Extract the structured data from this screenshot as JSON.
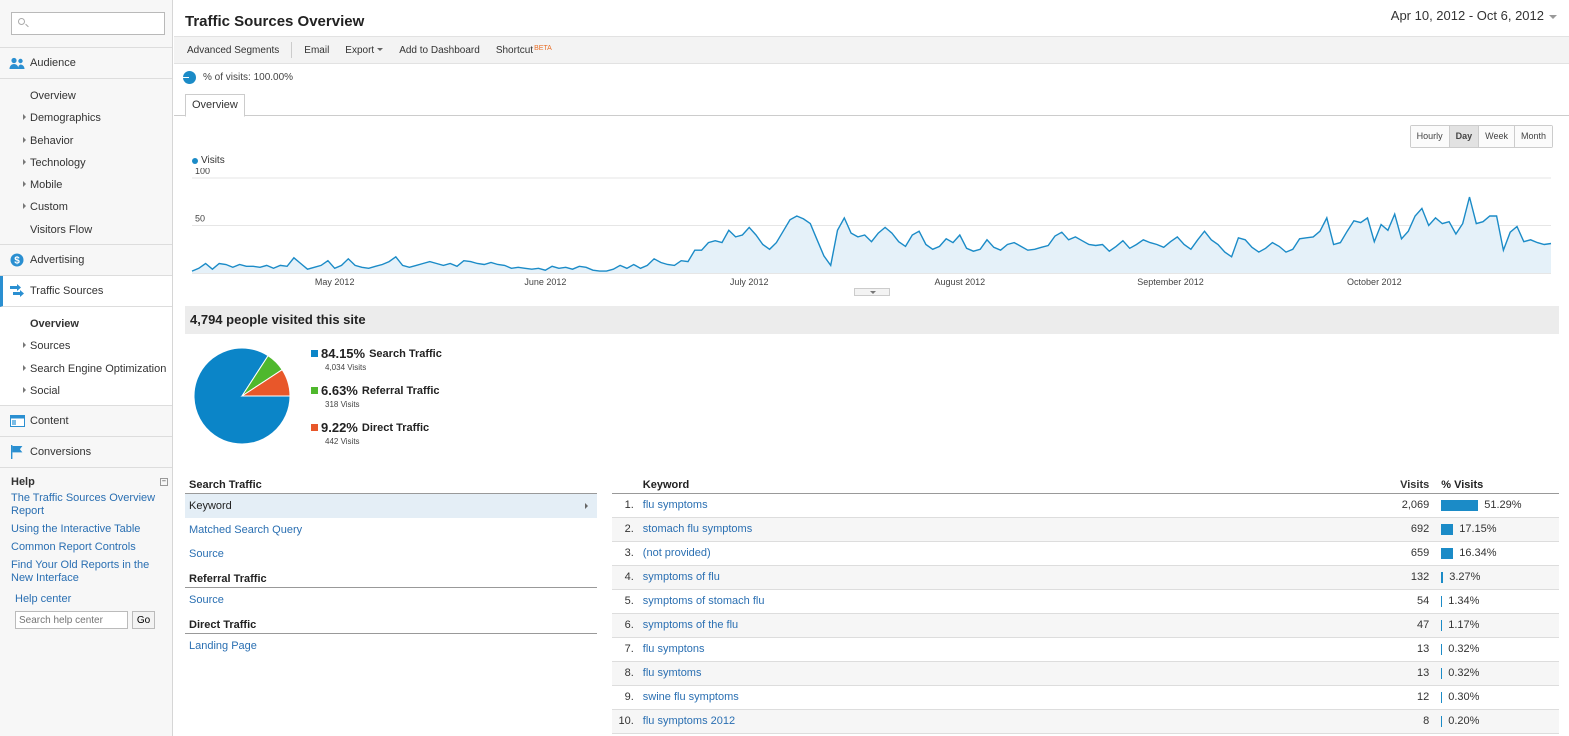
{
  "sidebar": {
    "search_placeholder": "",
    "audience": {
      "label": "Audience",
      "items": [
        {
          "label": "Overview",
          "arrow": false
        },
        {
          "label": "Demographics",
          "arrow": true
        },
        {
          "label": "Behavior",
          "arrow": true
        },
        {
          "label": "Technology",
          "arrow": true
        },
        {
          "label": "Mobile",
          "arrow": true
        },
        {
          "label": "Custom",
          "arrow": true
        },
        {
          "label": "Visitors Flow",
          "arrow": false
        }
      ]
    },
    "advertising": {
      "label": "Advertising"
    },
    "traffic_sources": {
      "label": "Traffic Sources",
      "items": [
        {
          "label": "Overview",
          "arrow": false,
          "current": true
        },
        {
          "label": "Sources",
          "arrow": true
        },
        {
          "label": "Search Engine Optimization",
          "arrow": true
        },
        {
          "label": "Social",
          "arrow": true
        }
      ]
    },
    "content": {
      "label": "Content"
    },
    "conversions": {
      "label": "Conversions"
    },
    "help": {
      "title": "Help",
      "links": [
        "The Traffic Sources Overview Report",
        "Using the Interactive Table",
        "Common Report Controls",
        "Find Your Old Reports in the New Interface"
      ],
      "help_center": "Help center",
      "search_placeholder": "Search help center",
      "go_label": "Go"
    }
  },
  "header": {
    "title": "Traffic Sources Overview",
    "date_range": "Apr 10, 2012 - Oct 6, 2012"
  },
  "toolbar": {
    "advanced_segments": "Advanced Segments",
    "email": "Email",
    "export": "Export",
    "add_to_dashboard": "Add to Dashboard",
    "shortcut": "Shortcut",
    "beta": "BETA"
  },
  "segment": {
    "label": "% of visits: 100.00%"
  },
  "tabs": [
    {
      "label": "Overview"
    }
  ],
  "granularity": [
    {
      "label": "Hourly",
      "selected": false
    },
    {
      "label": "Day",
      "selected": true
    },
    {
      "label": "Week",
      "selected": false
    },
    {
      "label": "Month",
      "selected": false
    }
  ],
  "summary": {
    "headline": "4,794 people visited this site"
  },
  "chart_data": [
    {
      "type": "area",
      "title": "",
      "series": [
        {
          "name": "Visits",
          "values": [
            2,
            5,
            10,
            4,
            10,
            9,
            6,
            9,
            7,
            7,
            6,
            8,
            5,
            8,
            7,
            16,
            10,
            4,
            6,
            8,
            13,
            5,
            8,
            15,
            8,
            6,
            5,
            7,
            9,
            12,
            17,
            8,
            6,
            8,
            10,
            12,
            10,
            8,
            10,
            7,
            13,
            12,
            10,
            9,
            11,
            9,
            8,
            5,
            6,
            5,
            4,
            5,
            3,
            7,
            5,
            6,
            4,
            7,
            6,
            3,
            2,
            2,
            4,
            8,
            5,
            9,
            5,
            8,
            15,
            11,
            9,
            8,
            13,
            12,
            24,
            24,
            32,
            34,
            32,
            45,
            38,
            40,
            48,
            40,
            30,
            25,
            32,
            44,
            56,
            60,
            57,
            52,
            35,
            18,
            8,
            45,
            58,
            42,
            38,
            40,
            33,
            42,
            48,
            42,
            33,
            28,
            40,
            44,
            30,
            25,
            28,
            36,
            32,
            40,
            26,
            23,
            25,
            35,
            27,
            24,
            30,
            32,
            28,
            24,
            25,
            27,
            29,
            39,
            43,
            35,
            38,
            34,
            30,
            29,
            30,
            23,
            28,
            34,
            26,
            30,
            35,
            32,
            30,
            27,
            33,
            38,
            30,
            25,
            35,
            44,
            35,
            30,
            22,
            17,
            37,
            35,
            27,
            22,
            26,
            32,
            28,
            22,
            25,
            36,
            37,
            38,
            44,
            58,
            30,
            32,
            44,
            55,
            53,
            58,
            33,
            51,
            45,
            62,
            36,
            44,
            60,
            68,
            50,
            58,
            52,
            54,
            41,
            52,
            80,
            52,
            54,
            60,
            60,
            24,
            43,
            49,
            33,
            35,
            32,
            30,
            31
          ],
          "color": "#1b8bc7"
        }
      ],
      "ylim": [
        0,
        100
      ],
      "yticks": [
        50,
        100
      ],
      "xticks": [
        "May 2012",
        "June 2012",
        "July 2012",
        "August 2012",
        "September 2012",
        "October 2012"
      ],
      "legend": "top-left"
    },
    {
      "type": "pie",
      "slices": [
        {
          "label": "Search Traffic",
          "percent": 84.15,
          "percent_label": "84.15%",
          "visits": "4,034 Visits",
          "color": "#0b85c8"
        },
        {
          "label": "Referral Traffic",
          "percent": 6.63,
          "percent_label": "6.63%",
          "visits": "318 Visits",
          "color": "#4fb82d"
        },
        {
          "label": "Direct Traffic",
          "percent": 9.22,
          "percent_label": "9.22%",
          "visits": "442 Visits",
          "color": "#e8572a"
        }
      ]
    }
  ],
  "dimensions": {
    "groups": [
      {
        "heading": "Search Traffic",
        "options": [
          {
            "label": "Keyword",
            "selected": true
          },
          {
            "label": "Matched Search Query"
          },
          {
            "label": "Source"
          }
        ]
      },
      {
        "heading": "Referral Traffic",
        "options": [
          {
            "label": "Source"
          }
        ]
      },
      {
        "heading": "Direct Traffic",
        "options": [
          {
            "label": "Landing Page"
          }
        ]
      }
    ]
  },
  "keywords": {
    "headers": {
      "keyword": "Keyword",
      "visits": "Visits",
      "pct": "% Visits"
    },
    "rows": [
      {
        "n": "1.",
        "keyword": "flu symptoms",
        "visits": "2,069",
        "pct": "51.29%",
        "pct_value": 51.29
      },
      {
        "n": "2.",
        "keyword": "stomach flu symptoms",
        "visits": "692",
        "pct": "17.15%",
        "pct_value": 17.15
      },
      {
        "n": "3.",
        "keyword": "(not provided)",
        "visits": "659",
        "pct": "16.34%",
        "pct_value": 16.34
      },
      {
        "n": "4.",
        "keyword": "symptoms of flu",
        "visits": "132",
        "pct": "3.27%",
        "pct_value": 3.27
      },
      {
        "n": "5.",
        "keyword": "symptoms of stomach flu",
        "visits": "54",
        "pct": "1.34%",
        "pct_value": 1.34
      },
      {
        "n": "6.",
        "keyword": "symptoms of the flu",
        "visits": "47",
        "pct": "1.17%",
        "pct_value": 1.17
      },
      {
        "n": "7.",
        "keyword": "flu symptons",
        "visits": "13",
        "pct": "0.32%",
        "pct_value": 0.32
      },
      {
        "n": "8.",
        "keyword": "flu symtoms",
        "visits": "13",
        "pct": "0.32%",
        "pct_value": 0.32
      },
      {
        "n": "9.",
        "keyword": "swine flu symptoms",
        "visits": "12",
        "pct": "0.30%",
        "pct_value": 0.3
      },
      {
        "n": "10.",
        "keyword": "flu symptoms 2012",
        "visits": "8",
        "pct": "0.20%",
        "pct_value": 0.2
      }
    ]
  }
}
